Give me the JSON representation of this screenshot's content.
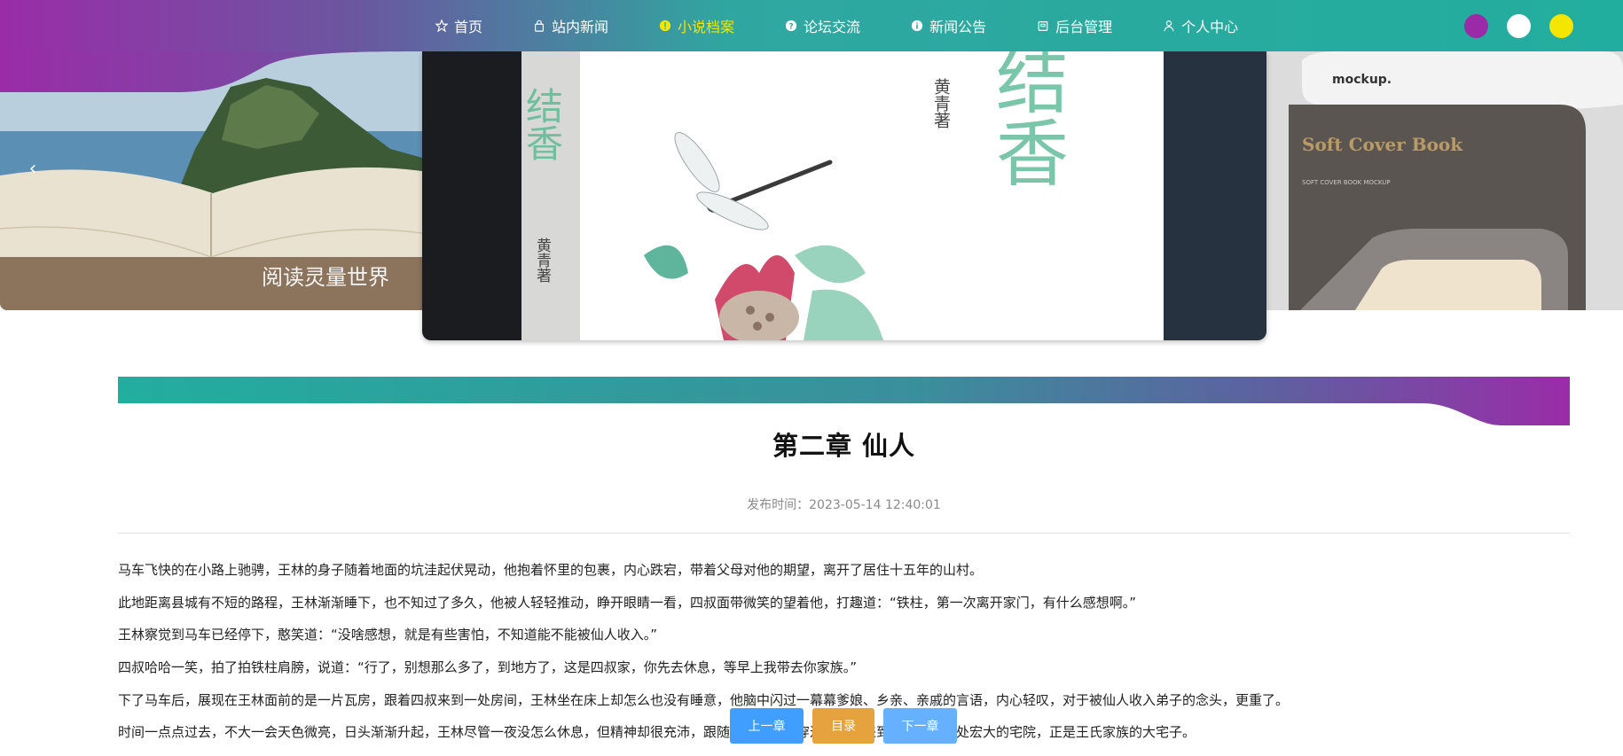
{
  "nav": {
    "items": [
      {
        "label": "首页",
        "icon": "star-icon",
        "active": false
      },
      {
        "label": "站内新闻",
        "icon": "bag-icon",
        "active": false
      },
      {
        "label": "小说档案",
        "icon": "info-icon",
        "active": true
      },
      {
        "label": "论坛交流",
        "icon": "question-icon",
        "active": false
      },
      {
        "label": "新闻公告",
        "icon": "info-circle-icon",
        "active": false
      },
      {
        "label": "后台管理",
        "icon": "building-icon",
        "active": false
      },
      {
        "label": "个人中心",
        "icon": "user-icon",
        "active": false
      }
    ],
    "theme_colors": [
      "#9b2aa6",
      "#ffffff",
      "#f5e600"
    ],
    "active_color": "#f5e600"
  },
  "carousel": {
    "left_caption": "阅读灵量世界",
    "center_author": "黄青著",
    "center_title_glyph": "结香",
    "spine_author": "黄青著",
    "right_brand": "mockup.",
    "right_title": "Soft Cover Book",
    "right_subtitle": "SOFT COVER BOOK MOCKUP"
  },
  "article": {
    "title": "第二章 仙人",
    "publish_label": "发布时间：2023-05-14 12:40:01",
    "paragraphs": [
      "马车飞快的在小路上驰骋，王林的身子随着地面的坑洼起伏晃动，他抱着怀里的包裹，内心跌宕，带着父母对他的期望，离开了居住十五年的山村。",
      "此地距离县城有不短的路程，王林渐渐睡下，也不知过了多久，他被人轻轻推动，睁开眼睛一看，四叔面带微笑的望着他，打趣道：“铁柱，第一次离开家门，有什么感想啊。”",
      "王林察觉到马车已经停下，憨笑道：“没啥感想，就是有些害怕，不知道能不能被仙人收入。”",
      "四叔哈哈一笑，拍了拍铁柱肩膀，说道：“行了，别想那么多了，到地方了，这是四叔家，你先去休息，等早上我带去你家族。”",
      "下了马车后，展现在王林面前的是一片瓦房，跟着四叔来到一处房间，王林坐在床上却怎么也没有睡意，他脑中闪过一幕幕爹娘、乡亲、亲戚的言语，内心轻叹，对于被仙人收入弟子的念头，更重了。",
      "时间一点点过去，不大一会天色微亮，日头渐渐升起，王林尽管一夜没怎么休息，但精神却很充沛，跟随四叔一起，穿过县城，来到县城东边一处宏大的宅院，正是王氏家族的大宅子。"
    ]
  },
  "buttons": {
    "prev": "上一章",
    "toc": "目录",
    "next": "下一章"
  }
}
